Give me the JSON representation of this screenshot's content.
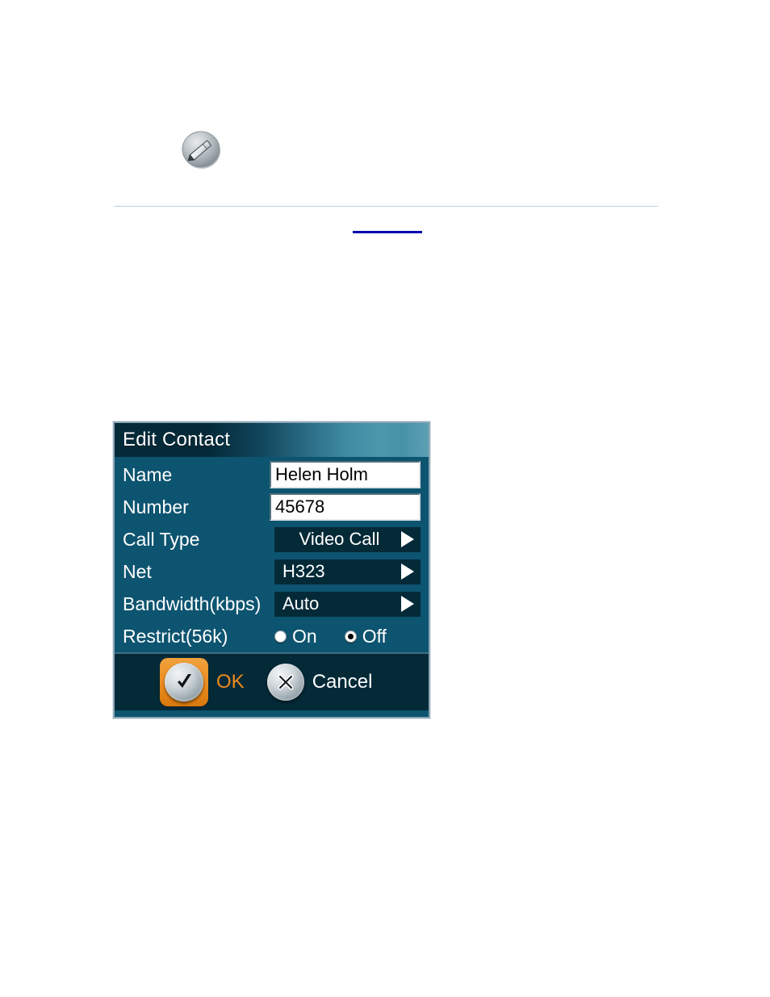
{
  "page": {
    "pencil_icon": "pencil-icon",
    "divider": "horizontal-rule",
    "link_underline": "blue-underline"
  },
  "dialog": {
    "title": "Edit Contact",
    "rows": [
      {
        "label": "Name",
        "type": "text",
        "value": "Helen Holm"
      },
      {
        "label": "Number",
        "type": "text",
        "value": "45678"
      },
      {
        "label": "Call Type",
        "type": "select",
        "value": "Video Call"
      },
      {
        "label": "Net",
        "type": "select",
        "value": "H323"
      },
      {
        "label": "Bandwidth(kbps)",
        "type": "select",
        "value": "Auto"
      },
      {
        "label": "Restrict(56k)",
        "type": "radio"
      }
    ],
    "radio": {
      "on_label": "On",
      "off_label": "Off",
      "selected": "Off"
    },
    "buttons": {
      "ok_label": "OK",
      "cancel_label": "Cancel",
      "ok_icon": "checkmark-icon",
      "cancel_icon": "close-x-icon",
      "selected": "OK"
    },
    "colors": {
      "body": "#0d5470",
      "title_dark": "#042a38",
      "title_light": "#4d97ac",
      "select_bg": "#042a38",
      "bar_bg": "#042a38",
      "accent_orange": "#ef8b1c",
      "border": "#8fa7b5"
    }
  }
}
